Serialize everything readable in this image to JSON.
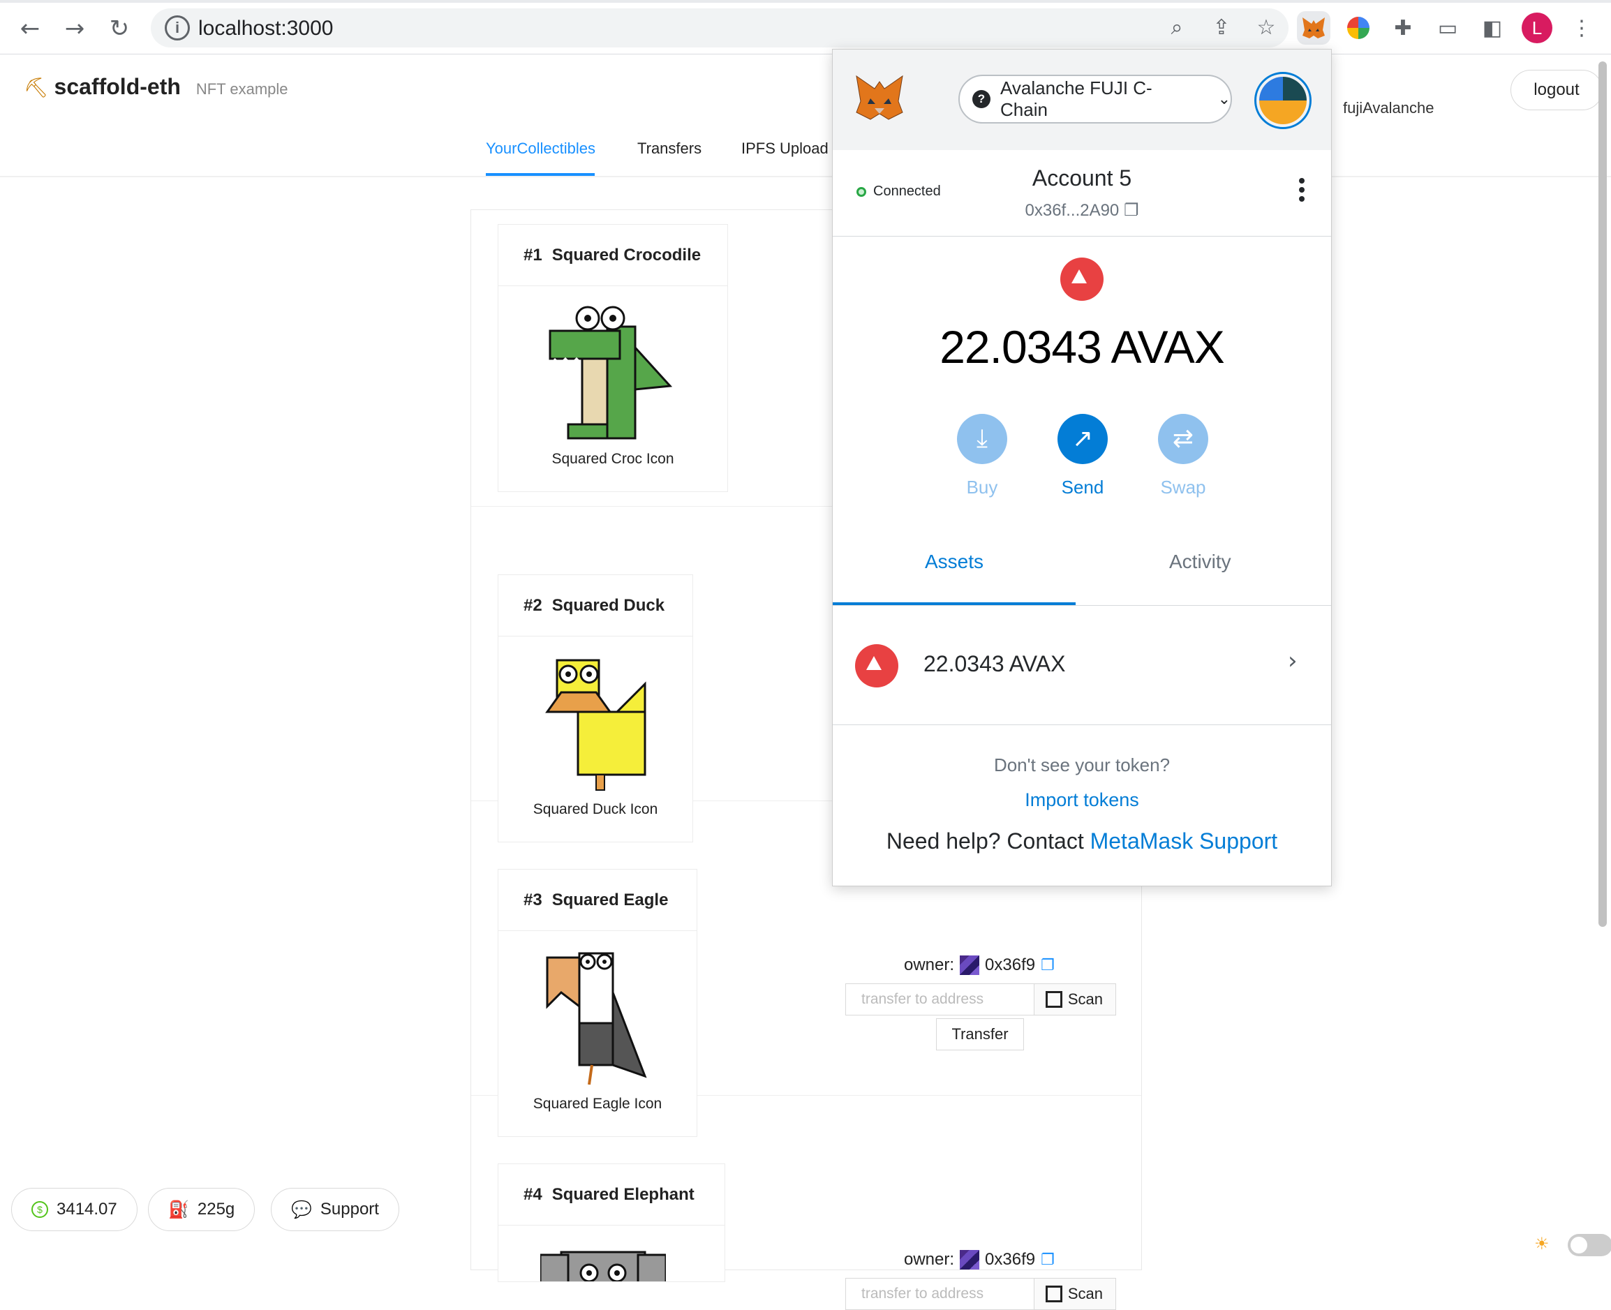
{
  "browser": {
    "url": "localhost:3000",
    "profile_initial": "L"
  },
  "app": {
    "brand_name": "scaffold-eth",
    "brand_sub": "NFT example",
    "account_label": "fujiAvalanche",
    "logout_label": "logout",
    "tabs": [
      {
        "label": "YourCollectibles",
        "active": true
      },
      {
        "label": "Transfers",
        "active": false
      },
      {
        "label": "IPFS Upload",
        "active": false
      }
    ],
    "collectibles": [
      {
        "num": "#1",
        "name": "Squared Crocodile",
        "caption": "Squared Croc Icon"
      },
      {
        "num": "#2",
        "name": "Squared Duck",
        "caption": "Squared Duck Icon"
      },
      {
        "num": "#3",
        "name": "Squared Eagle",
        "caption": "Squared Eagle Icon",
        "owner_label": "owner:",
        "owner_addr": "0x36f9",
        "input_placeholder": "transfer to address",
        "scan_label": "Scan",
        "transfer_label": "Transfer"
      },
      {
        "num": "#4",
        "name": "Squared Elephant",
        "owner_label": "owner:",
        "owner_addr": "0x36f9",
        "input_placeholder": "transfer to address",
        "scan_label": "Scan"
      }
    ],
    "footer": {
      "price": "3414.07",
      "gas": "225g",
      "support": "Support"
    }
  },
  "metamask": {
    "network": "Avalanche FUJI C-Chain",
    "connected_label": "Connected",
    "account_name": "Account 5",
    "account_addr": "0x36f...2A90",
    "balance": "22.0343 AVAX",
    "actions": [
      {
        "label": "Buy",
        "icon": "download-icon",
        "enabled": false
      },
      {
        "label": "Send",
        "icon": "arrow-up-right-icon",
        "enabled": true
      },
      {
        "label": "Swap",
        "icon": "swap-icon",
        "enabled": false
      }
    ],
    "tabs": [
      {
        "label": "Assets",
        "active": true
      },
      {
        "label": "Activity",
        "active": false
      }
    ],
    "asset_amount": "22.0343 AVAX",
    "dont_see": "Don't see your token?",
    "import_tokens": "Import tokens",
    "help_prefix": "Need help? Contact",
    "help_link": "MetaMask Support"
  },
  "colors": {
    "metamask_blue": "#037dd6",
    "antd_blue": "#1890ff",
    "avax_red": "#e84142"
  }
}
